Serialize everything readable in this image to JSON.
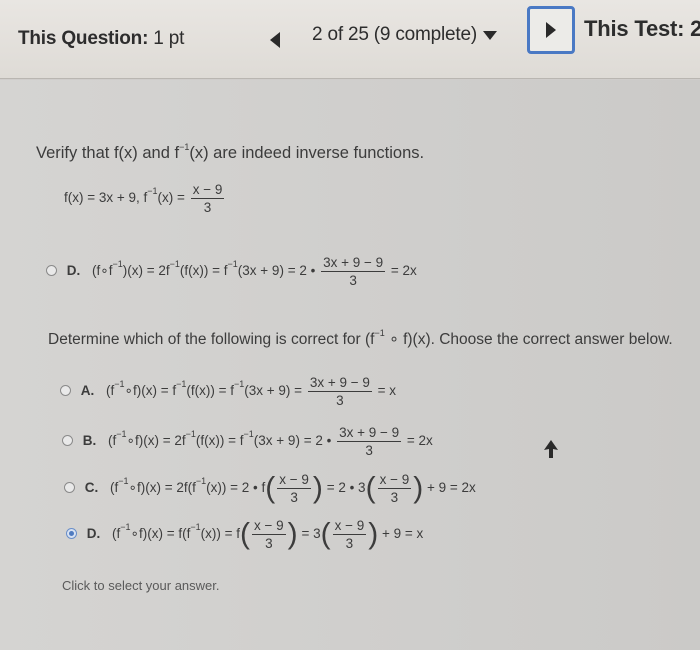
{
  "header": {
    "question_label": "This Question:",
    "points": "1 pt",
    "progress": "2 of 25 (9 complete)",
    "test_label": "This Test: 2"
  },
  "prompt": {
    "text_a": "Verify that f(x) and f",
    "sup": "−1",
    "text_b": "(x) are indeed inverse functions."
  },
  "given": {
    "lead": "f(x) = 3x + 9, f",
    "sup": "−1",
    "tail": "(x) =",
    "num": "x − 9",
    "den": "3"
  },
  "part1_option": {
    "letter": "D.",
    "a": "(f∘f",
    "sup1": "−1",
    "b": ")(x) = 2f",
    "sup2": "−1",
    "c": "(f(x)) = f",
    "sup3": "−1",
    "d": "(3x + 9) = 2 •",
    "num": "3x + 9 − 9",
    "den": "3",
    "e": "= 2x"
  },
  "determine": {
    "a": "Determine which of the following is correct for (f",
    "sup": "−1",
    "b": "∘ f)(x). Choose the correct answer below."
  },
  "options": [
    {
      "letter": "A.",
      "a": "(f",
      "b": "∘f)(x) = f",
      "c": "(f(x)) = f",
      "d": "(3x + 9) =",
      "num": "3x + 9 − 9",
      "den": "3",
      "e": "= x",
      "selected": false
    },
    {
      "letter": "B.",
      "a": "(f",
      "b": "∘f)(x) = 2f",
      "c": "(f(x)) = f",
      "d": "(3x + 9) = 2 •",
      "num": "3x + 9 − 9",
      "den": "3",
      "e": "= 2x",
      "selected": false
    },
    {
      "letter": "C.",
      "a": "(f",
      "b": "∘f)(x) = 2f(f",
      "c": "(x)) = 2 • f",
      "num1": "x − 9",
      "den1": "3",
      "d": "= 2 • 3",
      "num2": "x − 9",
      "den2": "3",
      "e": "+ 9 = 2x",
      "selected": false
    },
    {
      "letter": "D.",
      "a": "(f",
      "b": "∘f)(x) = f(f",
      "c": "(x)) = f",
      "num1": "x − 9",
      "den1": "3",
      "d": "= 3",
      "num2": "x − 9",
      "den2": "3",
      "e": "+ 9 = x",
      "selected": true
    }
  ],
  "sup_inv": "−1",
  "hint": "Click to select your answer.",
  "colors": {
    "accent": "#4a79c4",
    "selected_radio": "#4f7bc0"
  }
}
